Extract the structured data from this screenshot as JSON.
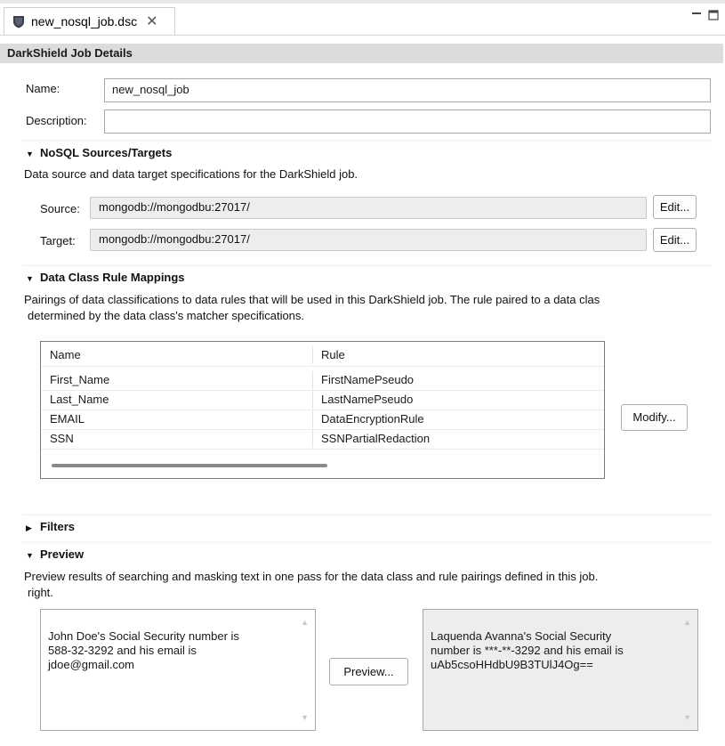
{
  "tab": {
    "file_name": "new_nosql_job.dsc",
    "close_glyph": "✕"
  },
  "window_controls": [
    "minimize-icon",
    "maximize-icon"
  ],
  "form": {
    "title": "DarkShield Job Details",
    "name_label": "Name:",
    "name_value": "new_nosql_job",
    "description_label": "Description:",
    "description_value": ""
  },
  "nosql": {
    "title": "NoSQL Sources/Targets",
    "description": "Data source and data target specifications for the DarkShield job.",
    "source_label": "Source:",
    "source_value": "mongodb://mongodbu:27017/",
    "target_label": "Target:",
    "target_value": "mongodb://mongodbu:27017/",
    "edit_label": "Edit..."
  },
  "mappings": {
    "title": "Data Class Rule Mappings",
    "description_line1": "Pairings of data classifications to data rules that will be used in this DarkShield job. The rule paired to a data clas",
    "description_line2": "determined by the data class's matcher specifications.",
    "columns": [
      "Name",
      "Rule"
    ],
    "rows": [
      {
        "name": "First_Name",
        "rule": "FirstNamePseudo"
      },
      {
        "name": "Last_Name",
        "rule": "LastNamePseudo"
      },
      {
        "name": "EMAIL",
        "rule": "DataEncryptionRule"
      },
      {
        "name": "SSN",
        "rule": "SSNPartialRedaction"
      }
    ],
    "modify_label": "Modify..."
  },
  "filters": {
    "title": "Filters"
  },
  "preview": {
    "title": "Preview",
    "description_line1": "Preview results of searching and masking text in one pass for the data class and rule pairings defined in this job.",
    "description_line2": "right.",
    "input_text": "John Doe's Social Security number is\n588-32-3292 and his email is\njdoe@gmail.com",
    "output_text": "Laquenda Avanna's Social Security\nnumber is ***-**-3292 and his email is\nuAb5csoHHdbU9B3TUlJ4Og==",
    "button_label": "Preview..."
  },
  "colors": {
    "header_bg": "#dcdcdc",
    "readonly_bg": "#ededed",
    "border": "#a9a9a9"
  }
}
